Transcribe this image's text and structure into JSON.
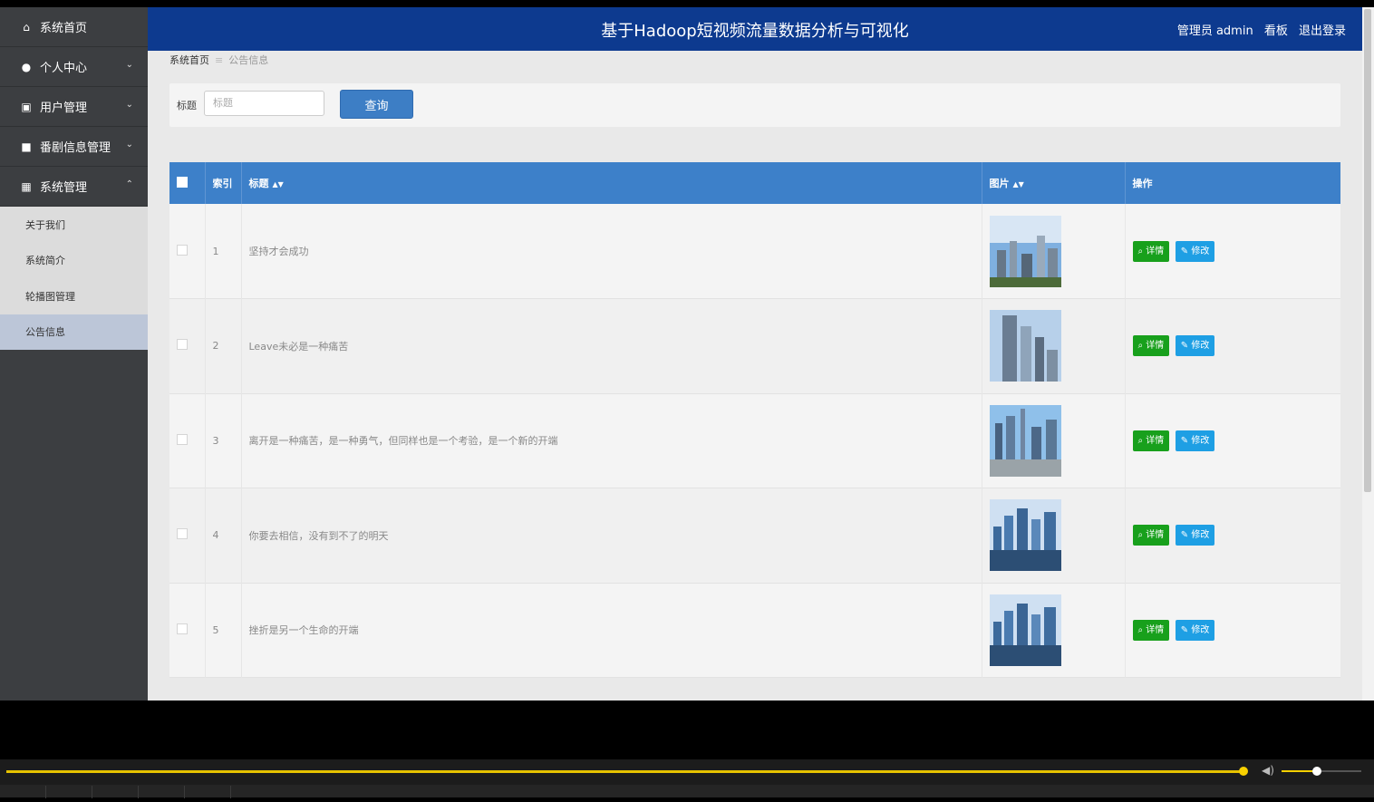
{
  "app": {
    "title": "基于Hadoop短视频流量数据分析与可视化",
    "user_label": "管理员 admin",
    "dashboard_link": "看板",
    "logout_link": "退出登录"
  },
  "sidebar": {
    "items": [
      {
        "label": "系统首页",
        "icon": "home-icon"
      },
      {
        "label": "个人中心",
        "icon": "user-icon"
      },
      {
        "label": "用户管理",
        "icon": "clipboard-icon"
      },
      {
        "label": "番剧信息管理",
        "icon": "book-icon"
      },
      {
        "label": "系统管理",
        "icon": "grid-icon"
      }
    ],
    "submenu": [
      {
        "label": "关于我们"
      },
      {
        "label": "系统简介"
      },
      {
        "label": "轮播图管理"
      },
      {
        "label": "公告信息",
        "active": true
      }
    ]
  },
  "breadcrumb": {
    "home": "系统首页",
    "current": "公告信息"
  },
  "search": {
    "label": "标题",
    "placeholder": "标题",
    "button": "查询"
  },
  "table": {
    "headers": {
      "index": "索引",
      "title": "标题",
      "image": "图片",
      "actions": "操作"
    },
    "detail_label": "详情",
    "edit_label": "修改",
    "rows": [
      {
        "index": "1",
        "title": "坚持才会成功"
      },
      {
        "index": "2",
        "title": "Leave未必是一种痛苦"
      },
      {
        "index": "3",
        "title": "离开是一种痛苦，是一种勇气，但同样也是一个考验，是一个新的开端"
      },
      {
        "index": "4",
        "title": "你要去相信，没有到不了的明天"
      },
      {
        "index": "5",
        "title": "挫折是另一个生命的开端"
      }
    ]
  },
  "colors": {
    "header": "#0d3a8f",
    "table_header": "#3d80c9",
    "detail": "#18a01c",
    "edit": "#1e9fe4"
  }
}
